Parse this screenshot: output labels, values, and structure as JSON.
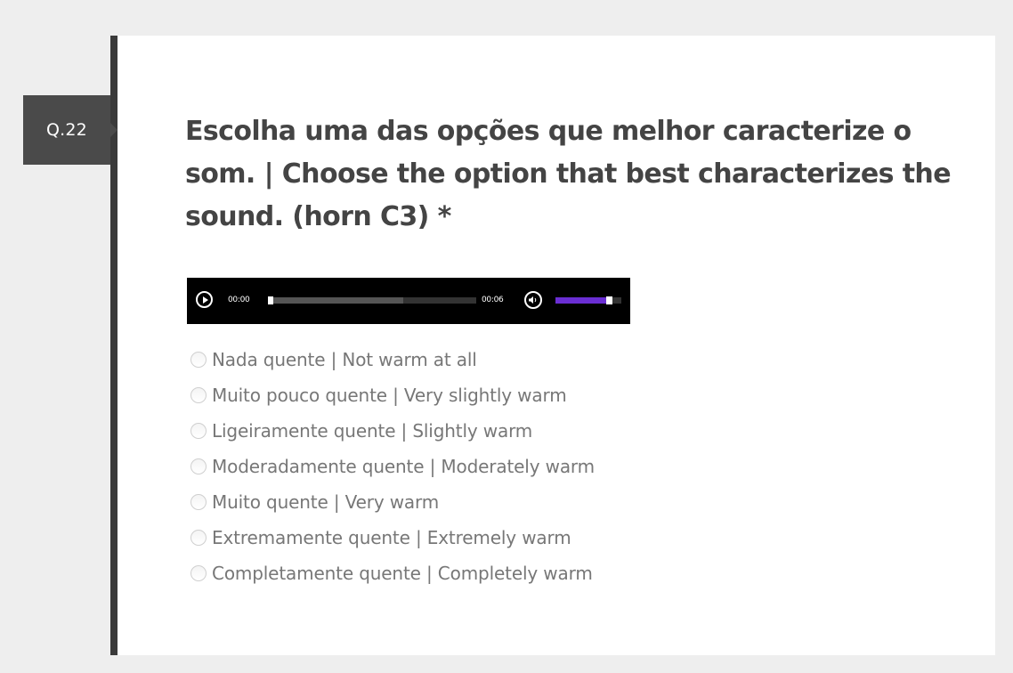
{
  "question": {
    "number": "Q.22",
    "title": "Escolha uma das opções que melhor caracterize o som. | Choose the option that best characterizes the sound. (horn C3) *"
  },
  "audio": {
    "current_time": "00:00",
    "duration": "00:06",
    "progress": 0.0,
    "buffered": 0.65,
    "volume": 0.8,
    "colors": {
      "background": "#000000",
      "volume_fill": "#6a2ed3"
    },
    "icons": {
      "play": "play-icon",
      "volume": "volume-icon"
    }
  },
  "options": [
    {
      "label": "Nada quente | Not warm at all",
      "selected": false
    },
    {
      "label": "Muito pouco quente | Very slightly warm",
      "selected": false
    },
    {
      "label": "Ligeiramente quente | Slightly warm",
      "selected": false
    },
    {
      "label": "Moderadamente quente | Moderately warm",
      "selected": false
    },
    {
      "label": "Muito quente | Very warm",
      "selected": false
    },
    {
      "label": "Extremamente quente | Extremely warm",
      "selected": false
    },
    {
      "label": "Completamente quente | Completely warm",
      "selected": false
    }
  ]
}
